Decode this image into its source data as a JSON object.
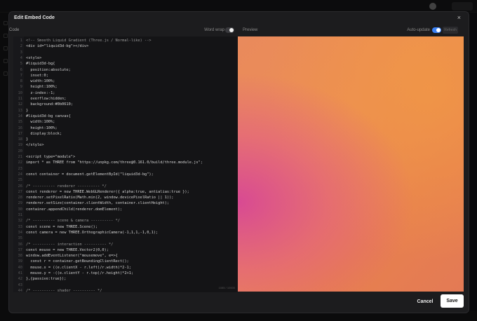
{
  "modal": {
    "title": "Edit Embed Code",
    "close_glyph": "×"
  },
  "code_panel": {
    "label": "Code",
    "word_wrap_label": "Word wrap",
    "word_wrap_on": false,
    "char_count": "1085 / 10000"
  },
  "preview_panel": {
    "label": "Preview",
    "auto_update_label": "Auto-update",
    "auto_update_on": true,
    "refresh_label": "Refresh",
    "gradient_colors": [
      "#d84a96",
      "#ec8e54",
      "#e37a55"
    ]
  },
  "footer": {
    "cancel_label": "Cancel",
    "save_label": "Save"
  },
  "code_lines": [
    "<!-- Smooth Liquid Gradient (Three.js / Normal-like) -->",
    "<div id=\"liquid3d-bg\"></div>",
    "",
    "<style>",
    "#liquid3d-bg{",
    "  position:absolute;",
    "  inset:0;",
    "  width:100%;",
    "  height:100%;",
    "  z-index:-1;",
    "  overflow:hidden;",
    "  background:#0b0610;",
    "}",
    "#liquid3d-bg canvas{",
    "  width:100%;",
    "  height:100%;",
    "  display:block;",
    "}",
    "</style>",
    "",
    "<script type=\"module\">",
    "import * as THREE from \"https://unpkg.com/three@0.161.0/build/three.module.js\";",
    "",
    "const container = document.getElementById(\"liquid3d-bg\");",
    "",
    "/* ---------- renderer ---------- */",
    "const renderer = new THREE.WebGLRenderer({ alpha:true, antialias:true });",
    "renderer.setPixelRatio(Math.min(2, window.devicePixelRatio || 1));",
    "renderer.setSize(container.clientWidth, container.clientHeight);",
    "container.appendChild(renderer.domElement);",
    "",
    "/* ---------- scene & camera ---------- */",
    "const scene = new THREE.Scene();",
    "const camera = new THREE.OrthographicCamera(-1,1,1,-1,0,1);",
    "",
    "/* ---------- interaction ---------- */",
    "const mouse = new THREE.Vector2(0,0);",
    "window.addEventListener(\"mousemove\", e=>{",
    "  const r = container.getBoundingClientRect();",
    "  mouse.x = ((e.clientX - r.left)/r.width)*2-1;",
    "  mouse.y = -((e.clientY - r.top)/r.height)*2+1;",
    "},{passive:true});",
    "",
    "/* ---------- shader ---------- */"
  ]
}
